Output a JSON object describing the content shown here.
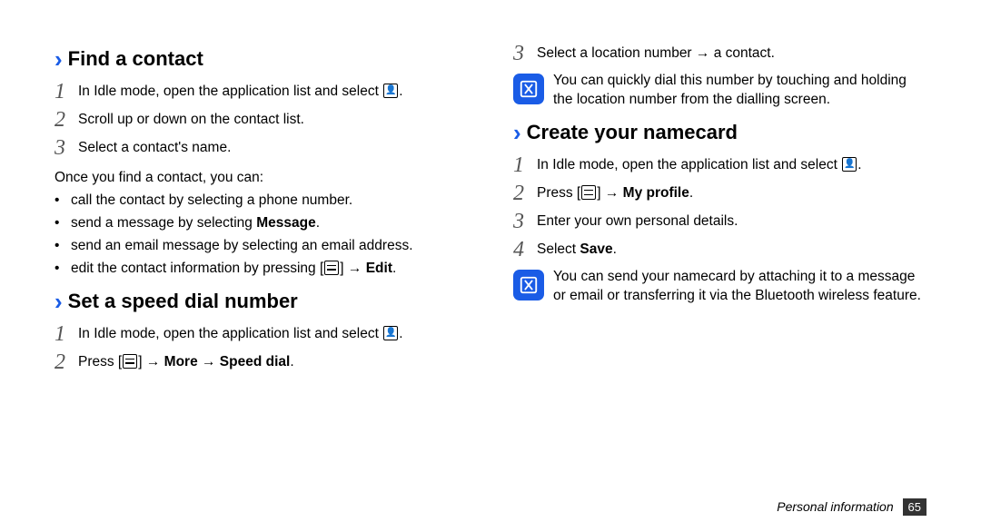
{
  "left": {
    "section1": {
      "title": "Find a contact",
      "steps": [
        {
          "n": "1",
          "before": "In Idle mode, open the application list and select ",
          "icon": "contacts",
          "after": "."
        },
        {
          "n": "2",
          "text": "Scroll up or down on the contact list."
        },
        {
          "n": "3",
          "text": "Select a contact's name."
        }
      ],
      "after_para": "Once you find a contact, you can:",
      "bullets": [
        {
          "text": "call the contact by selecting a phone number."
        },
        {
          "pre": "send a message by selecting ",
          "bold": "Message",
          "post": "."
        },
        {
          "text": "send an email message by selecting an email address."
        },
        {
          "pre": "edit the contact information by pressing [",
          "icon": "menu",
          "mid": "] → ",
          "bold": "Edit",
          "post": "."
        }
      ]
    },
    "section2": {
      "title": "Set a speed dial number",
      "steps": [
        {
          "n": "1",
          "before": "In Idle mode, open the application list and select ",
          "icon": "contacts",
          "after": "."
        },
        {
          "n": "2",
          "pre": "Press [",
          "icon": "menu",
          "mid": "] → ",
          "bold": "More → Speed dial",
          "post": "."
        }
      ]
    }
  },
  "right": {
    "top_step": {
      "n": "3",
      "text": "Select a location number → a contact."
    },
    "note1": "You can quickly dial this number by touching and holding the location number from the dialling screen.",
    "section3": {
      "title": "Create your namecard",
      "steps": [
        {
          "n": "1",
          "before": "In Idle mode, open the application list and select ",
          "icon": "contacts",
          "after": "."
        },
        {
          "n": "2",
          "pre": "Press [",
          "icon": "menu",
          "mid": "] → ",
          "bold": "My profile",
          "post": "."
        },
        {
          "n": "3",
          "text": "Enter your own personal details."
        },
        {
          "n": "4",
          "pre": "Select ",
          "bold": "Save",
          "post": "."
        }
      ]
    },
    "note2": "You can send your namecard by attaching it to a message or email or transferring it via the Bluetooth wireless feature."
  },
  "footer": {
    "label": "Personal information",
    "page": "65"
  }
}
